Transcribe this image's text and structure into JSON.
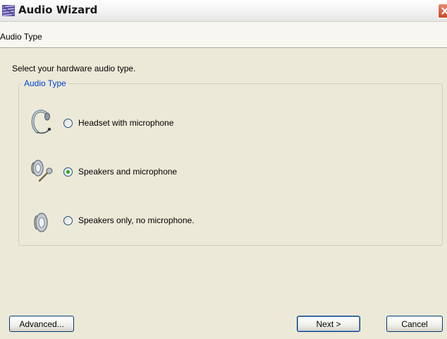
{
  "window": {
    "title": "Audio Wizard"
  },
  "header": {
    "title": "Audio Type"
  },
  "instruction": "Select your hardware audio type.",
  "group": {
    "legend": "Audio Type",
    "options": [
      {
        "label": "Headset with microphone",
        "icon": "headset-icon",
        "selected": false
      },
      {
        "label": "Speakers and microphone",
        "icon": "speaker-microphone-icon",
        "selected": true
      },
      {
        "label": "Speakers only, no microphone.",
        "icon": "speaker-icon",
        "selected": false
      }
    ]
  },
  "buttons": {
    "advanced": "Advanced...",
    "next": "Next >",
    "cancel": "Cancel"
  },
  "colors": {
    "legend": "#0046d5",
    "background": "#ece9d8",
    "radio_dot": "#21a121"
  }
}
